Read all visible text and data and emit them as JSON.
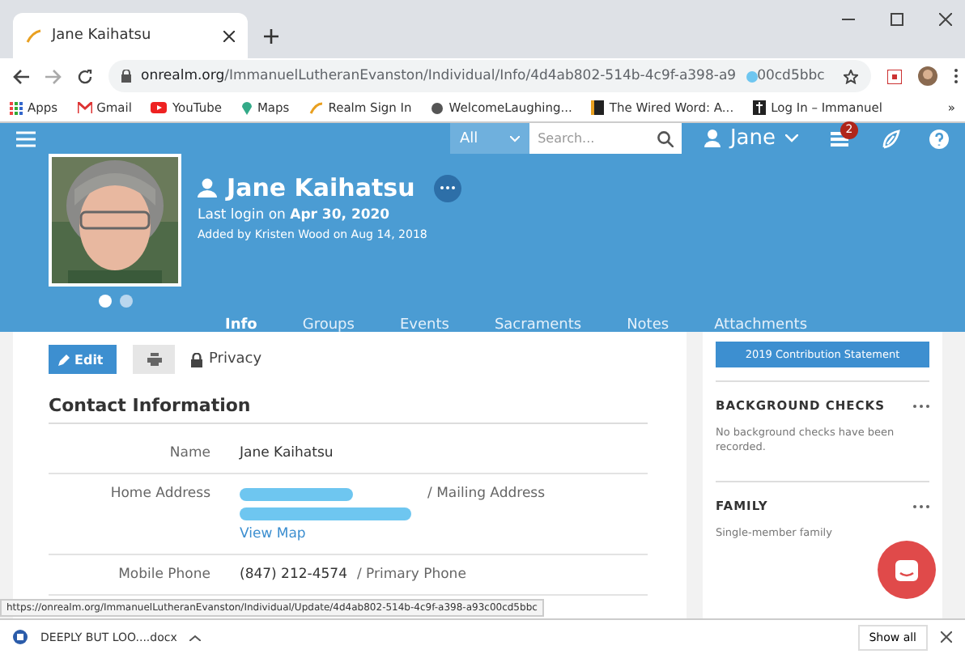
{
  "browser": {
    "tab_title": "Jane Kaihatsu",
    "url_host": "onrealm.org",
    "url_path": "/ImmanuelLutheranEvanston/Individual/Info/4d4ab802-514b-4c9f-a398-a9",
    "url_tail": "00cd5bbc",
    "bookmarks": [
      {
        "kind": "apps",
        "label": "Apps"
      },
      {
        "kind": "gmail",
        "label": "Gmail"
      },
      {
        "kind": "youtube",
        "label": "YouTube"
      },
      {
        "kind": "maps",
        "label": "Maps"
      },
      {
        "kind": "realm",
        "label": "Realm Sign In"
      },
      {
        "kind": "globe",
        "label": "WelcomeLaughing..."
      },
      {
        "kind": "book",
        "label": "The Wired Word: A..."
      },
      {
        "kind": "cross",
        "label": "Log In – Immanuel"
      }
    ],
    "more": "»"
  },
  "topbar": {
    "scope": "All",
    "search_placeholder": "Search...",
    "user": "Jane",
    "badge": "2"
  },
  "profile": {
    "name": "Jane Kaihatsu",
    "last_login_prefix": "Last login on",
    "last_login_date": "Apr 30, 2020",
    "added": "Added by Kristen Wood on Aug 14, 2018",
    "photo_dots": [
      {
        "selected": true
      },
      {
        "selected": false
      }
    ]
  },
  "tabs": [
    {
      "label": "Info",
      "selected": true
    },
    {
      "label": "Groups",
      "selected": false
    },
    {
      "label": "Events",
      "selected": false
    },
    {
      "label": "Sacraments",
      "selected": false
    },
    {
      "label": "Notes",
      "selected": false
    },
    {
      "label": "Attachments",
      "selected": false
    }
  ],
  "actions": {
    "edit": "Edit",
    "privacy": "Privacy"
  },
  "contact": {
    "title": "Contact Information",
    "rows": [
      {
        "kind": "text",
        "label": "Name",
        "value": "Jane Kaihatsu"
      },
      {
        "kind": "address",
        "label": "Home Address",
        "note": "/ Mailing Address",
        "link": "View Map"
      },
      {
        "kind": "text",
        "label": "Mobile Phone",
        "value": "(847) 212-4574",
        "note": "/ Primary Phone"
      }
    ]
  },
  "sidebar": {
    "button": "2019 Contribution Statement",
    "sections": [
      {
        "title": "BACKGROUND CHECKS",
        "body": "No background checks have been recorded."
      },
      {
        "title": "FAMILY",
        "body": "Single-member family"
      }
    ]
  },
  "status_url": "https://onrealm.org/ImmanuelLutheranEvanston/Individual/Update/4d4ab802-514b-4c9f-a398-a93c00cd5bbc",
  "download": {
    "file": "DEEPLY BUT LOO....docx",
    "show_all": "Show all"
  }
}
